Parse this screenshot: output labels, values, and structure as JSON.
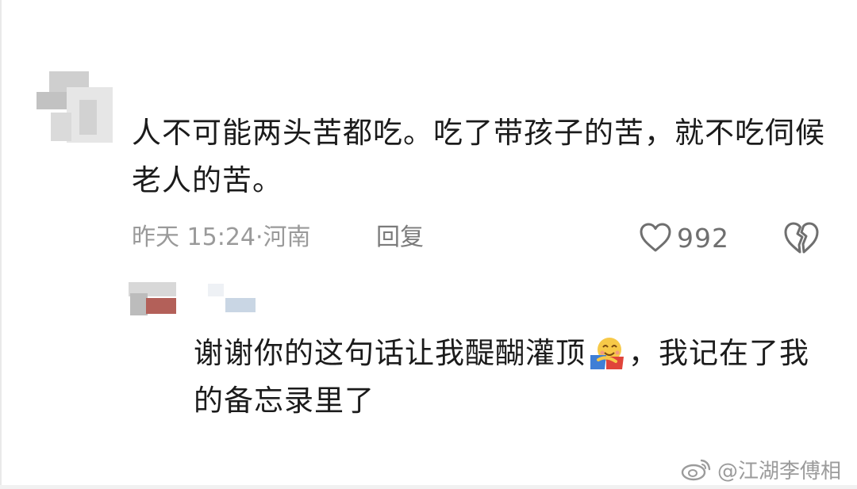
{
  "main_comment": {
    "text": "人不可能两头苦都吃。吃了带孩子的苦，就不吃伺候老人的苦。",
    "time": "昨天 15:24",
    "separator": "·",
    "location": "河南",
    "reply_label": "回复",
    "like_count": "992",
    "like_icon": "heart-outline-icon",
    "dislike_icon": "broken-heart-icon"
  },
  "reply_comment": {
    "text_before_emoji": "谢谢你的这句话让我醍醐灌顶",
    "emoji": "hugging-face-emoji",
    "text_after_emoji": "，我记在了我的备忘录里了"
  },
  "watermark": {
    "text": "@江湖李傅相",
    "icon": "weibo-logo-icon"
  },
  "colors": {
    "primary_text": "#1b1b1b",
    "meta_text": "#9a9a9a",
    "reply_label": "#7b7b7b",
    "icon_stroke": "#6f6f6f",
    "watermark": "#9b9b9b"
  }
}
